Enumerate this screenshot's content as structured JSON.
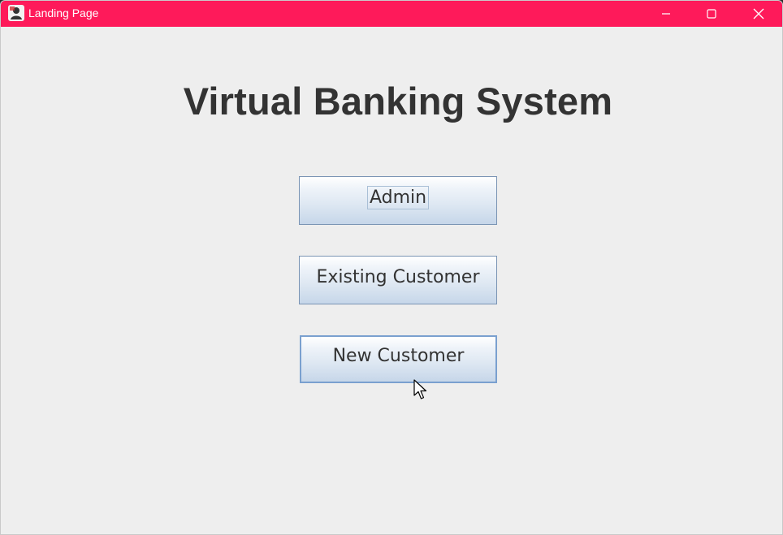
{
  "window": {
    "title": "Landing Page",
    "titlebar_color": "#fe1a5a",
    "controls": {
      "minimize_icon": "minimize-icon",
      "maximize_icon": "maximize-icon",
      "close_icon": "close-icon"
    }
  },
  "main": {
    "heading": "Virtual Banking System",
    "buttons": [
      {
        "label": "Admin",
        "focused": true
      },
      {
        "label": "Existing Customer",
        "focused": false
      },
      {
        "label": "New Customer",
        "hovered": true
      }
    ]
  }
}
